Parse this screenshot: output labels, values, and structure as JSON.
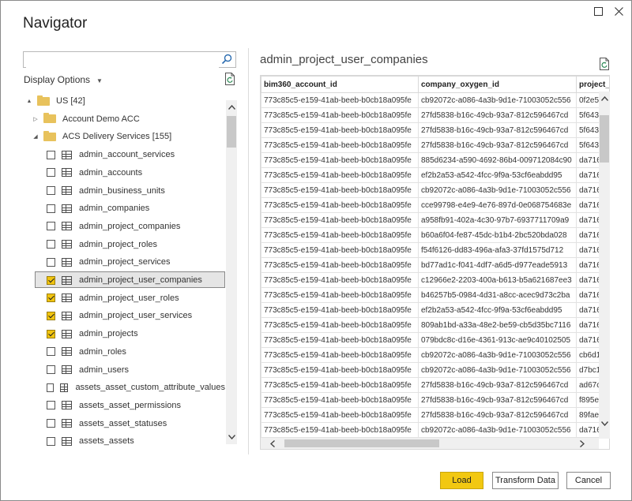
{
  "window": {
    "title": "Navigator",
    "maximize_icon": "maximize-icon",
    "close_icon": "close-icon"
  },
  "left": {
    "search": {
      "value": "",
      "placeholder": ""
    },
    "display_options": "Display Options",
    "tree": [
      {
        "type": "folder",
        "label": "US [42]",
        "expander": "▲",
        "indent": 0
      },
      {
        "type": "folder",
        "label": "Account Demo ACC",
        "expander": "▷",
        "indent": 1
      },
      {
        "type": "folder",
        "label": "ACS Delivery Services [155]",
        "expander": "◢",
        "indent": 1
      },
      {
        "type": "table",
        "label": "admin_account_services",
        "checked": false
      },
      {
        "type": "table",
        "label": "admin_accounts",
        "checked": false
      },
      {
        "type": "table",
        "label": "admin_business_units",
        "checked": false
      },
      {
        "type": "table",
        "label": "admin_companies",
        "checked": false
      },
      {
        "type": "table",
        "label": "admin_project_companies",
        "checked": false
      },
      {
        "type": "table",
        "label": "admin_project_roles",
        "checked": false
      },
      {
        "type": "table",
        "label": "admin_project_services",
        "checked": false
      },
      {
        "type": "table",
        "label": "admin_project_user_companies",
        "checked": true,
        "selected": true
      },
      {
        "type": "table",
        "label": "admin_project_user_roles",
        "checked": true
      },
      {
        "type": "table",
        "label": "admin_project_user_services",
        "checked": true
      },
      {
        "type": "table",
        "label": "admin_projects",
        "checked": true
      },
      {
        "type": "table",
        "label": "admin_roles",
        "checked": false
      },
      {
        "type": "table",
        "label": "admin_users",
        "checked": false
      },
      {
        "type": "table",
        "label": "assets_asset_custom_attribute_values",
        "checked": false
      },
      {
        "type": "table",
        "label": "assets_asset_permissions",
        "checked": false
      },
      {
        "type": "table",
        "label": "assets_asset_statuses",
        "checked": false
      },
      {
        "type": "table",
        "label": "assets_assets",
        "checked": false
      }
    ]
  },
  "preview": {
    "title": "admin_project_user_companies",
    "columns": [
      "bim360_account_id",
      "company_oxygen_id",
      "project_i"
    ],
    "rows": [
      [
        "773c85c5-e159-41ab-beeb-b0cb18a095fe",
        "cb92072c-a086-4a3b-9d1e-71003052c556",
        "0f2e5"
      ],
      [
        "773c85c5-e159-41ab-beeb-b0cb18a095fe",
        "27fd5838-b16c-49cb-93a7-812c596467cd",
        "5f643"
      ],
      [
        "773c85c5-e159-41ab-beeb-b0cb18a095fe",
        "27fd5838-b16c-49cb-93a7-812c596467cd",
        "5f643"
      ],
      [
        "773c85c5-e159-41ab-beeb-b0cb18a095fe",
        "27fd5838-b16c-49cb-93a7-812c596467cd",
        "5f643"
      ],
      [
        "773c85c5-e159-41ab-beeb-b0cb18a095fe",
        "885d6234-a590-4692-86b4-009712084c90",
        "da716"
      ],
      [
        "773c85c5-e159-41ab-beeb-b0cb18a095fe",
        "ef2b2a53-a542-4fcc-9f9a-53cf6eabdd95",
        "da716"
      ],
      [
        "773c85c5-e159-41ab-beeb-b0cb18a095fe",
        "cb92072c-a086-4a3b-9d1e-71003052c556",
        "da716"
      ],
      [
        "773c85c5-e159-41ab-beeb-b0cb18a095fe",
        "cce99798-e4e9-4e76-897d-0e068754683e",
        "da716"
      ],
      [
        "773c85c5-e159-41ab-beeb-b0cb18a095fe",
        "a958fb91-402a-4c30-97b7-6937711709a9",
        "da716"
      ],
      [
        "773c85c5-e159-41ab-beeb-b0cb18a095fe",
        "b60a6f04-fe87-45dc-b1b4-2bc520bda028",
        "da716"
      ],
      [
        "773c85c5-e159-41ab-beeb-b0cb18a095fe",
        "f54f6126-dd83-496a-afa3-37fd1575d712",
        "da716"
      ],
      [
        "773c85c5-e159-41ab-beeb-b0cb18a095fe",
        "bd77ad1c-f041-4df7-a6d5-d977eade5913",
        "da716"
      ],
      [
        "773c85c5-e159-41ab-beeb-b0cb18a095fe",
        "c12966e2-2203-400a-b613-b5a621687ee3",
        "da716"
      ],
      [
        "773c85c5-e159-41ab-beeb-b0cb18a095fe",
        "b46257b5-0984-4d31-a8cc-acec9d73c2ba",
        "da716"
      ],
      [
        "773c85c5-e159-41ab-beeb-b0cb18a095fe",
        "ef2b2a53-a542-4fcc-9f9a-53cf6eabdd95",
        "da716"
      ],
      [
        "773c85c5-e159-41ab-beeb-b0cb18a095fe",
        "809ab1bd-a33a-48e2-be59-cb5d35bc7116",
        "da716"
      ],
      [
        "773c85c5-e159-41ab-beeb-b0cb18a095fe",
        "079bdc8c-d16e-4361-913c-ae9c40102505",
        "da716"
      ],
      [
        "773c85c5-e159-41ab-beeb-b0cb18a095fe",
        "cb92072c-a086-4a3b-9d1e-71003052c556",
        "cb6d1"
      ],
      [
        "773c85c5-e159-41ab-beeb-b0cb18a095fe",
        "cb92072c-a086-4a3b-9d1e-71003052c556",
        "d7bc1"
      ],
      [
        "773c85c5-e159-41ab-beeb-b0cb18a095fe",
        "27fd5838-b16c-49cb-93a7-812c596467cd",
        "ad67c"
      ],
      [
        "773c85c5-e159-41ab-beeb-b0cb18a095fe",
        "27fd5838-b16c-49cb-93a7-812c596467cd",
        "f895e"
      ],
      [
        "773c85c5-e159-41ab-beeb-b0cb18a095fe",
        "27fd5838-b16c-49cb-93a7-812c596467cd",
        "89fae"
      ],
      [
        "773c85c5-e159-41ab-beeb-b0cb18a095fe",
        "cb92072c-a086-4a3b-9d1e-71003052c556",
        "da716"
      ]
    ]
  },
  "buttons": {
    "load": "Load",
    "transform": "Transform Data",
    "cancel": "Cancel"
  },
  "colors": {
    "accent": "#f2c811",
    "folder": "#e8c25c"
  }
}
